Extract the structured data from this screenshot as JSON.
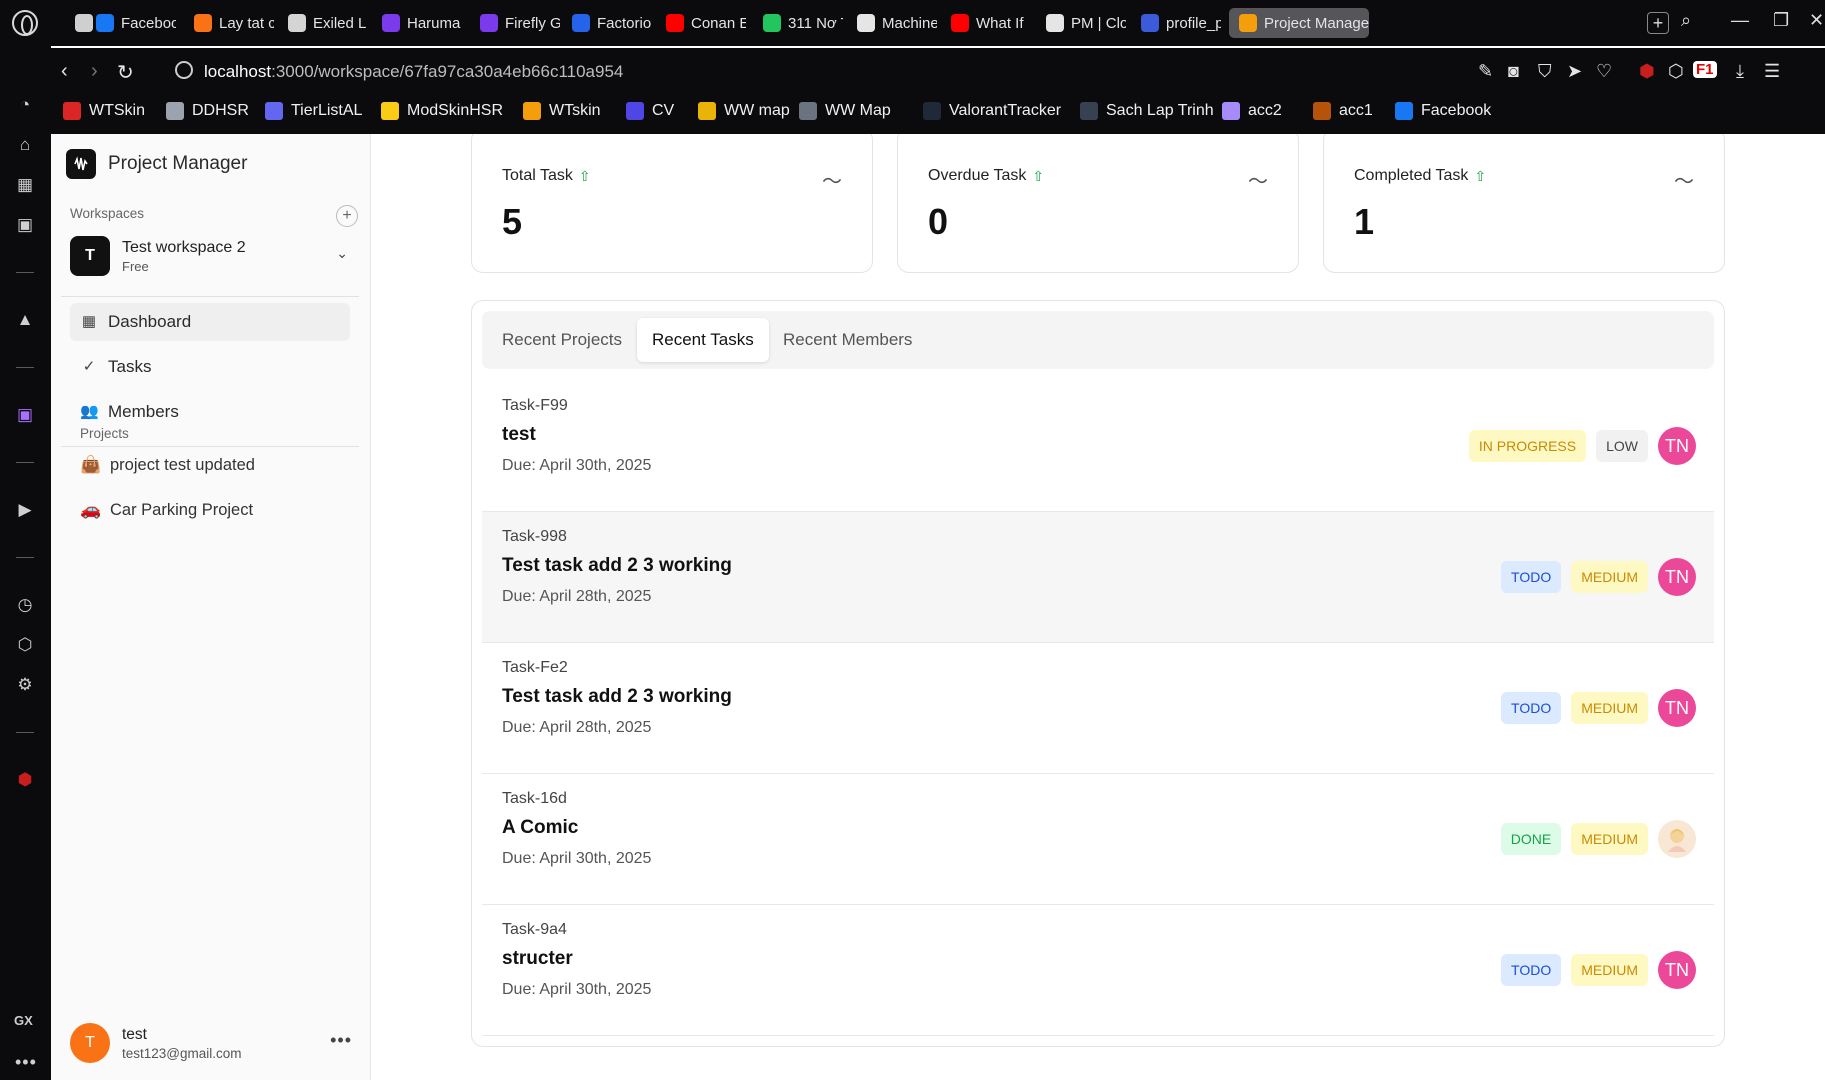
{
  "browser": {
    "tabs": [
      {
        "label": "Faceboo",
        "color": "#1877f2"
      },
      {
        "label": "Lay tat c",
        "color": "#f97316"
      },
      {
        "label": "Exiled L",
        "color": "#d4d4d4"
      },
      {
        "label": "Haruma",
        "color": "#7c3aed"
      },
      {
        "label": "Firefly G",
        "color": "#7c3aed"
      },
      {
        "label": "Factorio",
        "color": "#2563eb"
      },
      {
        "label": "Conan E",
        "color": "#ff0000"
      },
      {
        "label": "311 Nơ T",
        "color": "#22c55e"
      },
      {
        "label": "Machine",
        "color": "#e5e5e5"
      },
      {
        "label": "What If",
        "color": "#ff0000"
      },
      {
        "label": "PM | Clo",
        "color": "#e5e5e5"
      },
      {
        "label": "profile_p",
        "color": "#3b5bdb"
      },
      {
        "label": "Project Manage",
        "color": "#f59e0b"
      }
    ],
    "url_host": "localhost",
    "url_path": ":3000/workspace/67fa97ca30a4eb66c110a954",
    "bookmarks": [
      {
        "label": "WTSkin",
        "color": "#dc2626"
      },
      {
        "label": "DDHSR",
        "color": "#9ca3af"
      },
      {
        "label": "TierListAL",
        "color": "#6366f1"
      },
      {
        "label": "ModSkinHSR",
        "color": "#facc15"
      },
      {
        "label": "WTskin",
        "color": "#f59e0b"
      },
      {
        "label": "CV",
        "color": "#4f46e5"
      },
      {
        "label": "WW map",
        "color": "#eab308"
      },
      {
        "label": "WW Map",
        "color": "#6b7280"
      },
      {
        "label": "ValorantTracker",
        "color": "#1f2937"
      },
      {
        "label": "Sach Lap Trinh",
        "color": "#374151"
      },
      {
        "label": "acc2",
        "color": "#a78bfa"
      },
      {
        "label": "acc1",
        "color": "#b45309"
      },
      {
        "label": "Facebook",
        "color": "#1877f2"
      }
    ],
    "rail_bottom_label": "GX"
  },
  "app": {
    "brand": "Project Manager",
    "workspaces_label": "Workspaces",
    "workspace": {
      "initial": "T",
      "name": "Test workspace 2",
      "plan": "Free"
    },
    "nav": [
      {
        "label": "Dashboard",
        "icon": "dashboard-grid-icon",
        "active": true
      },
      {
        "label": "Tasks",
        "icon": "check-circle-icon",
        "active": false
      },
      {
        "label": "Members",
        "icon": "users-icon",
        "active": false
      }
    ],
    "projects_label": "Projects",
    "projects": [
      {
        "emoji": "👜",
        "label": "project test updated"
      },
      {
        "emoji": "🚗",
        "label": "Car Parking Project"
      }
    ],
    "user": {
      "initial": "T",
      "name": "test",
      "email": "test123@gmail.com"
    }
  },
  "stats": [
    {
      "title": "Total Task",
      "value": "5"
    },
    {
      "title": "Overdue Task",
      "value": "0"
    },
    {
      "title": "Completed Task",
      "value": "1"
    }
  ],
  "panel": {
    "tabs": [
      "Recent Projects",
      "Recent Tasks",
      "Recent Members"
    ],
    "active_tab": "Recent Tasks",
    "tasks": [
      {
        "code": "Task-F99",
        "title": "test",
        "due": "Due: April 30th, 2025",
        "status": "IN PROGRESS",
        "priority": "LOW",
        "assignee": "TN"
      },
      {
        "code": "Task-998",
        "title": "Test task add 2 3 working",
        "due": "Due: April 28th, 2025",
        "status": "TODO",
        "priority": "MEDIUM",
        "assignee": "TN"
      },
      {
        "code": "Task-Fe2",
        "title": "Test task add 2 3 working",
        "due": "Due: April 28th, 2025",
        "status": "TODO",
        "priority": "MEDIUM",
        "assignee": "TN"
      },
      {
        "code": "Task-16d",
        "title": "A Comic",
        "due": "Due: April 30th, 2025",
        "status": "DONE",
        "priority": "MEDIUM",
        "assignee": ""
      },
      {
        "code": "Task-9a4",
        "title": "structer",
        "due": "Due: April 30th, 2025",
        "status": "TODO",
        "priority": "MEDIUM",
        "assignee": "TN"
      }
    ]
  },
  "colors": {
    "status_inprogress": "#ca8a04",
    "status_todo": "#1d4ed8",
    "status_done": "#16a34a",
    "assignee_bg": "#ec4899",
    "user_avatar_bg": "#f97316",
    "trend_up": "#16a34a"
  }
}
